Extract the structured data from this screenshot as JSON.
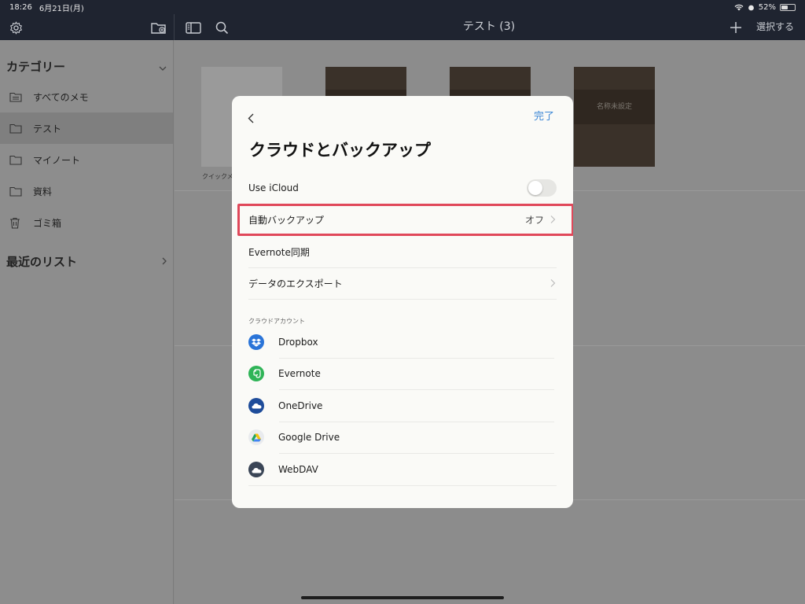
{
  "status_bar": {
    "time": "18:26",
    "date": "6月21日(月)",
    "battery": "52%",
    "battery_level": 0.52
  },
  "nav": {
    "title": "テスト (3)",
    "select_label": "選択する"
  },
  "sidebar": {
    "categories_title": "カテゴリー",
    "items": [
      {
        "label": "すべてのメモ",
        "icon": "notes-folder-icon",
        "active": false
      },
      {
        "label": "テスト",
        "icon": "folder-icon",
        "active": true
      },
      {
        "label": "マイノート",
        "icon": "folder-icon",
        "active": false
      },
      {
        "label": "資料",
        "icon": "folder-icon",
        "active": false
      },
      {
        "label": "ゴミ箱",
        "icon": "trash-icon",
        "active": false
      }
    ],
    "recent_title": "最近のリスト"
  },
  "main": {
    "notes": [
      {
        "title": "クイックメ"
      },
      {
        "title": ""
      },
      {
        "title": ""
      },
      {
        "title": "名称未設定"
      }
    ]
  },
  "modal": {
    "done_label": "完了",
    "title": "クラウドとバックアップ",
    "rows": {
      "icloud": {
        "label": "Use iCloud",
        "enabled": false
      },
      "auto_backup": {
        "label": "自動バックアップ",
        "value": "オフ"
      },
      "evernote_sync": {
        "label": "Evernote同期"
      },
      "export": {
        "label": "データのエクスポート"
      }
    },
    "accounts_header": "クラウドアカウント",
    "accounts": [
      {
        "name": "Dropbox",
        "icon": "dropbox-icon",
        "color": "#2a74d8"
      },
      {
        "name": "Evernote",
        "icon": "evernote-icon",
        "color": "#2fb457"
      },
      {
        "name": "OneDrive",
        "icon": "onedrive-icon",
        "color": "#1e4c9a"
      },
      {
        "name": "Google Drive",
        "icon": "google-drive-icon",
        "color": "#e9ebee"
      },
      {
        "name": "WebDAV",
        "icon": "webdav-icon",
        "color": "#3a4556"
      }
    ]
  },
  "colors": {
    "accent": "#3b86d6",
    "highlight": "#e0485a",
    "navbar": "#1f2430"
  }
}
